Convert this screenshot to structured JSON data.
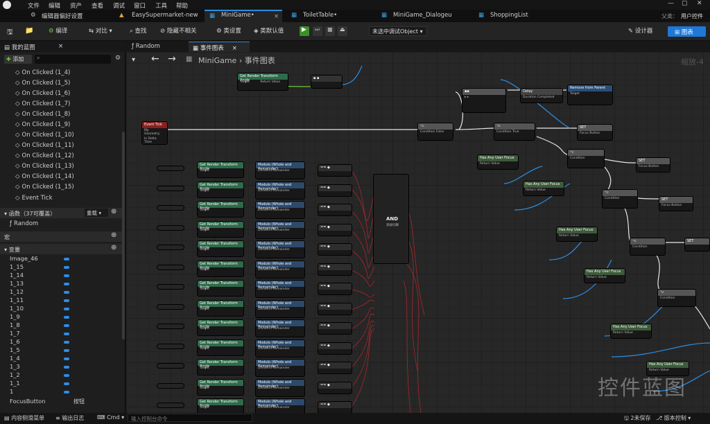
{
  "menu": {
    "items": [
      "文件",
      "编辑",
      "资产",
      "查看",
      "调试",
      "窗口",
      "工具",
      "帮助"
    ]
  },
  "tabs": [
    {
      "label": "编辑器偏好设置"
    },
    {
      "label": "EasySupermarket-new"
    },
    {
      "label": "MiniGame•"
    },
    {
      "label": "ToiletTable•"
    },
    {
      "label": "MiniGame_Dialogeu"
    },
    {
      "label": "ShoppingList"
    }
  ],
  "window": {
    "parent_label": "父类：",
    "parent_value": "用户控件"
  },
  "toolbar": {
    "compile": "编译",
    "diff": "对比",
    "find": "查找",
    "hide_unrelated": "隐藏不相关",
    "class_settings": "类设置",
    "class_defaults": "类默认值",
    "debug_object": "未选中调试Object",
    "designer": "设计器",
    "graph": "图表"
  },
  "left": {
    "panel_title": "我的蓝图",
    "add": "添加",
    "events": [
      "On Clicked (1_4)",
      "On Clicked (1_5)",
      "On Clicked (1_6)",
      "On Clicked (1_7)",
      "On Clicked (1_8)",
      "On Clicked (1_9)",
      "On Clicked (1_10)",
      "On Clicked (1_11)",
      "On Clicked (1_12)",
      "On Clicked (1_13)",
      "On Clicked (1_14)",
      "On Clicked (1_15)",
      "Event Tick"
    ],
    "functions_label": "函数（37可覆盖）",
    "override": "重载",
    "function_items": [
      "Random"
    ],
    "macros_label": "宏",
    "variables_label": "变量",
    "variables": [
      "Image_46",
      "1_15",
      "1_14",
      "1_13",
      "1_12",
      "1_11",
      "1_10",
      "1_9",
      "1_8",
      "1_7",
      "1_6",
      "1_5",
      "1_4",
      "1_3",
      "1_2",
      "1_1",
      "1"
    ],
    "focus_var": "FocusButton",
    "focus_type": "按钮"
  },
  "graph": {
    "tabs": [
      "Random",
      "事件图表"
    ],
    "breadcrumb_root": "MiniGame",
    "breadcrumb_sep": "›",
    "breadcrumb_leaf": "事件图表",
    "zoom": "缩放-4",
    "watermark": "控件蓝图",
    "nodes": {
      "event_tick": "Event Tick",
      "my_geometry": "My Geometry",
      "delta_time": "In Delta Time",
      "get_angle": "Get Render Transform Angle",
      "target": "Target",
      "return_value": "Return Value",
      "branch_true": "True",
      "branch_false": "False",
      "condition": "Condition",
      "delay": "Delay",
      "completed": "Completed",
      "duration": "Duration",
      "remove": "Remove from Parent",
      "and": "AND",
      "add_pin": "添加引脚",
      "set": "SET",
      "focus_button": "Focus Button",
      "has_focus": "Has Any User Focus",
      "mod": "Modulo (Whole and Remainder)",
      "dividend": "Dividend",
      "divisor": "Divisor",
      "remainder": "Remainder"
    }
  },
  "status": {
    "drawer": "内容侧滑菜单",
    "output": "输出日志",
    "cmd": "Cmd",
    "console_placeholder": "输入控制台命令",
    "save": "2未保存",
    "source_control": "版本控制"
  }
}
